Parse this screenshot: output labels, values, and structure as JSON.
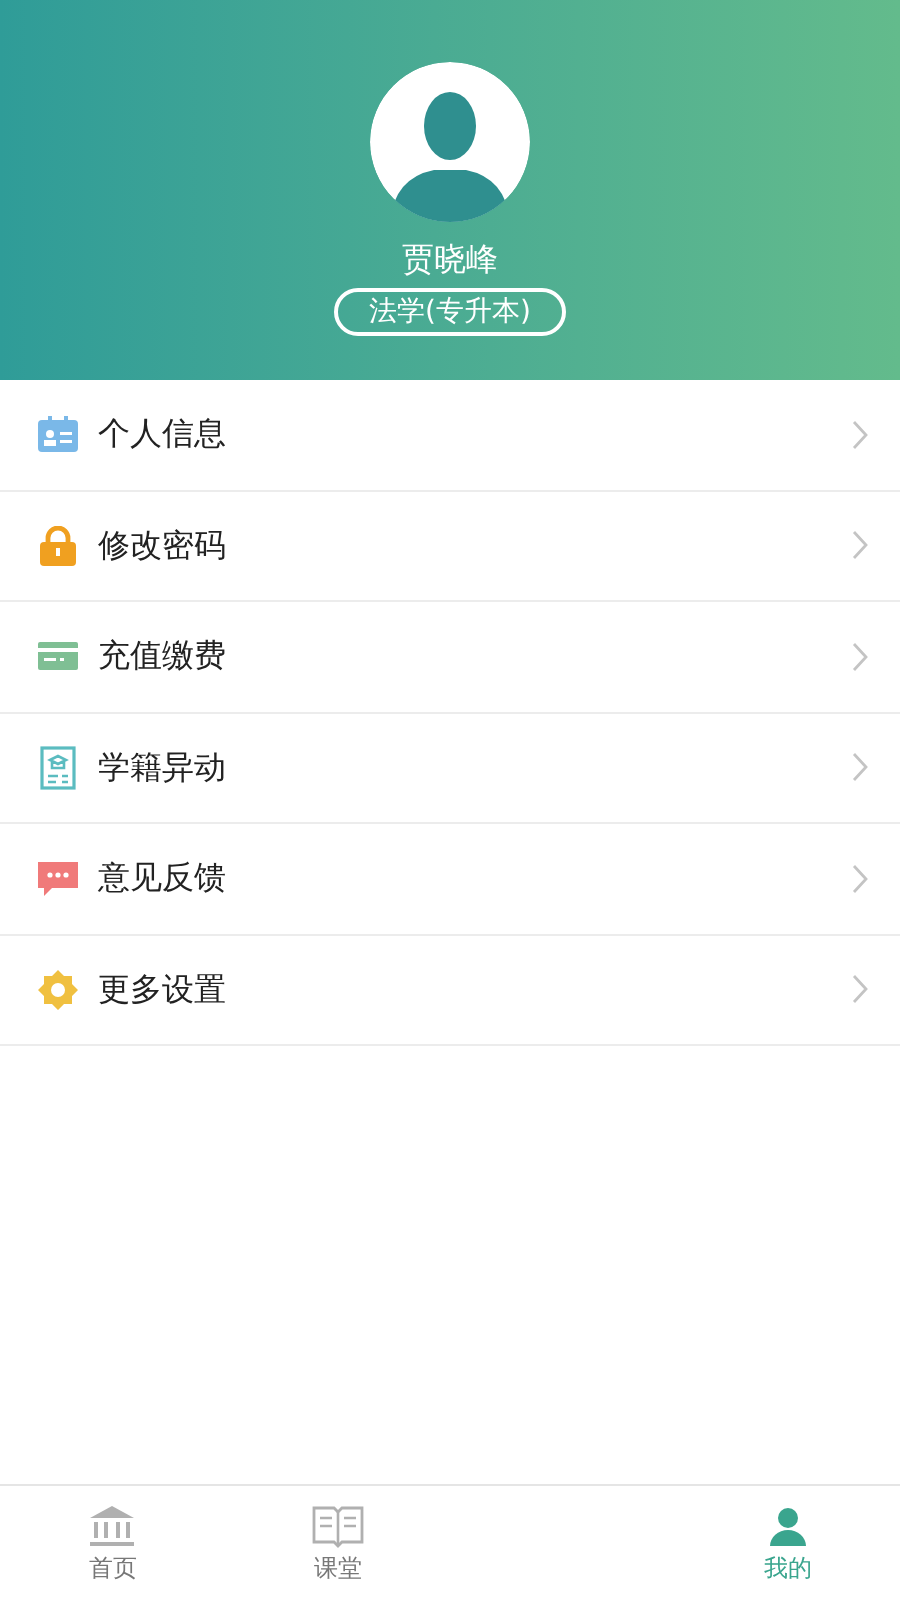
{
  "profile": {
    "name": "贾晓峰",
    "major": "法学(专升本)"
  },
  "menu": [
    {
      "label": "个人信息",
      "kind": "id-card"
    },
    {
      "label": "修改密码",
      "kind": "lock"
    },
    {
      "label": "充值缴费",
      "kind": "card"
    },
    {
      "label": "学籍异动",
      "kind": "certificate"
    },
    {
      "label": "意见反馈",
      "kind": "chat"
    },
    {
      "label": "更多设置",
      "kind": "gear"
    }
  ],
  "tabs": [
    {
      "label": "首页",
      "kind": "bank",
      "selected": false
    },
    {
      "label": "课堂",
      "kind": "book",
      "selected": false
    },
    {
      "label": "我的",
      "kind": "person",
      "selected": true
    }
  ]
}
